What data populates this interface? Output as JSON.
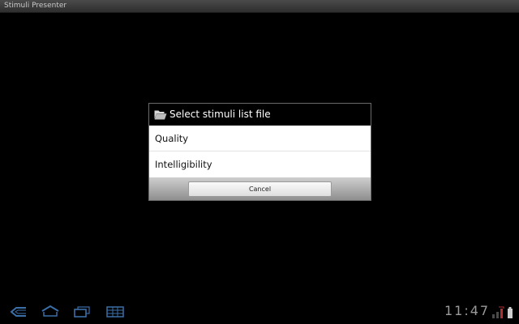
{
  "window": {
    "title": "Stimuli Presenter"
  },
  "dialog": {
    "title": "Select stimuli list file",
    "title_icon": "folder-open-icon",
    "items": [
      {
        "label": "Quality"
      },
      {
        "label": "Intelligibility"
      }
    ],
    "cancel_label": "Cancel"
  },
  "navbar": {
    "icons": [
      "back-icon",
      "home-icon",
      "recent-apps-icon",
      "menu-icon"
    ],
    "clock": "11:47",
    "status_icons": [
      "signal-icon",
      "battery-icon"
    ]
  },
  "colors": {
    "background": "#000000",
    "dialog_header": "#000000",
    "nav_icon": "#3b6fa8",
    "clock": "#9a9a9a"
  }
}
